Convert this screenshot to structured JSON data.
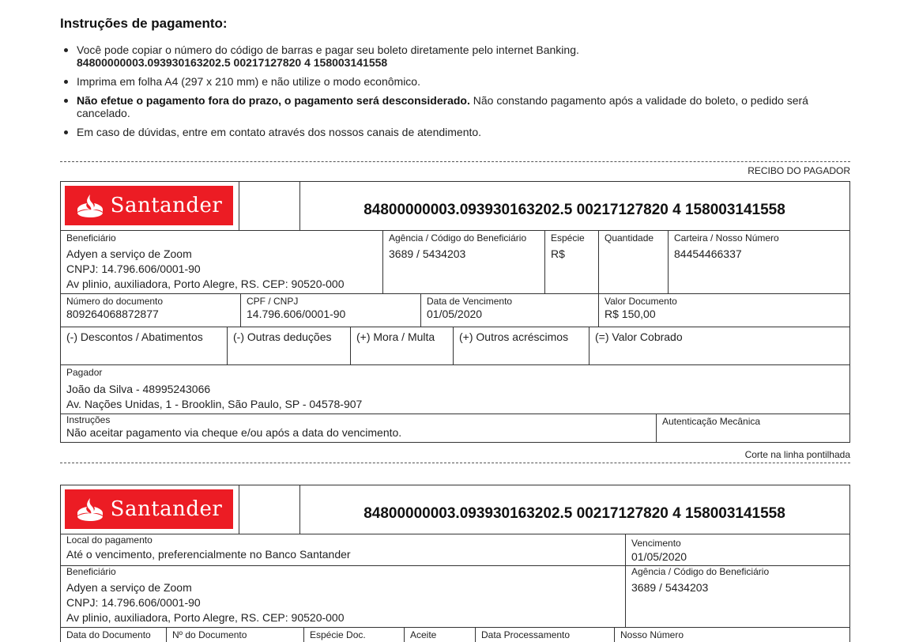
{
  "instrucoes": {
    "titulo": "Instruções de pagamento:",
    "item1_texto": "Você pode copiar o número do código de barras e pagar seu boleto diretamente pelo internet Banking.",
    "item1_linha": "84800000003.093930163202.5 00217127820 4 158003141558",
    "item2_texto": "Imprima em folha A4 (297 x 210 mm) e não utilize o modo econômico.",
    "item3_negrito": "Não efetue o pagamento fora do prazo, o pagamento será desconsiderado.",
    "item3_texto": " Não constando pagamento após a validade do boleto, o pedido será cancelado.",
    "item4_texto": "Em caso de dúvidas, entre em contato através dos nossos canais de atendimento."
  },
  "recibo": {
    "titulo": "RECIBO DO PAGADOR",
    "banco_nome": "Santander",
    "linha_digitavel": "84800000003.093930163202.5 00217127820 4 158003141558",
    "beneficiario_label": "Beneficiário",
    "beneficiario_nome": "Adyen a serviço de Zoom",
    "beneficiario_cnpj": "CNPJ: 14.796.606/0001-90",
    "beneficiario_endereco": "Av plinio, auxiliadora, Porto Alegre, RS. CEP: 90520-000",
    "agencia_label": "Agência / Código do Beneficiário",
    "agencia_valor": "3689 / 5434203",
    "especie_label": "Espécie",
    "especie_valor": "R$",
    "quantidade_label": "Quantidade",
    "carteira_label": "Carteira / Nosso Número",
    "carteira_valor": "84454466337",
    "num_doc_label": "Número do documento",
    "num_doc_valor": "809264068872877",
    "cpf_label": "CPF / CNPJ",
    "cpf_valor": "14.796.606/0001-90",
    "vencimento_label": "Data de Vencimento",
    "vencimento_valor": "01/05/2020",
    "valor_doc_label": "Valor Documento",
    "valor_doc_valor": "R$ 150,00",
    "descontos_label": "(-) Descontos / Abatimentos",
    "deducoes_label": "(-) Outras deduções",
    "mora_label": "(+) Mora / Multa",
    "acrescimos_label": "(+) Outros acréscimos",
    "cobrado_label": "(=) Valor Cobrado",
    "pagador_label": "Pagador",
    "pagador_nome": "João da Silva - 48995243066",
    "pagador_endereco": "Av. Nações Unidas, 1 - Brooklin, São Paulo, SP - 04578-907",
    "instrucoes_label": "Instruções",
    "instrucoes_valor": "Não aceitar pagamento via cheque e/ou após a data do vencimento.",
    "autenticacao_label": "Autenticação Mecânica",
    "corte": "Corte na linha pontilhada"
  },
  "ficha": {
    "banco_nome": "Santander",
    "linha_digitavel": "84800000003.093930163202.5 00217127820 4 158003141558",
    "local_label": "Local do pagamento",
    "local_valor": "Até o vencimento, preferencialmente no Banco Santander",
    "vencimento_label": "Vencimento",
    "vencimento_valor": "01/05/2020",
    "beneficiario_label": "Beneficiário",
    "beneficiario_nome": "Adyen a serviço de Zoom",
    "beneficiario_cnpj": "CNPJ: 14.796.606/0001-90",
    "beneficiario_endereco": "Av plinio, auxiliadora, Porto Alegre, RS. CEP: 90520-000",
    "agencia_label": "Agência / Código do Beneficiário",
    "agencia_valor": "3689 / 5434203",
    "data_doc_label": "Data do Documento",
    "num_doc_label": "Nº do Documento",
    "especie_doc_label": "Espécie Doc.",
    "aceite_label": "Aceite",
    "data_proc_label": "Data Processamento",
    "nosso_numero_label": "Nosso Número"
  },
  "colors": {
    "brand": "#ec1c24",
    "border": "#333333",
    "text": "#222222"
  },
  "icons": {
    "logo": "santander-flame-icon"
  }
}
